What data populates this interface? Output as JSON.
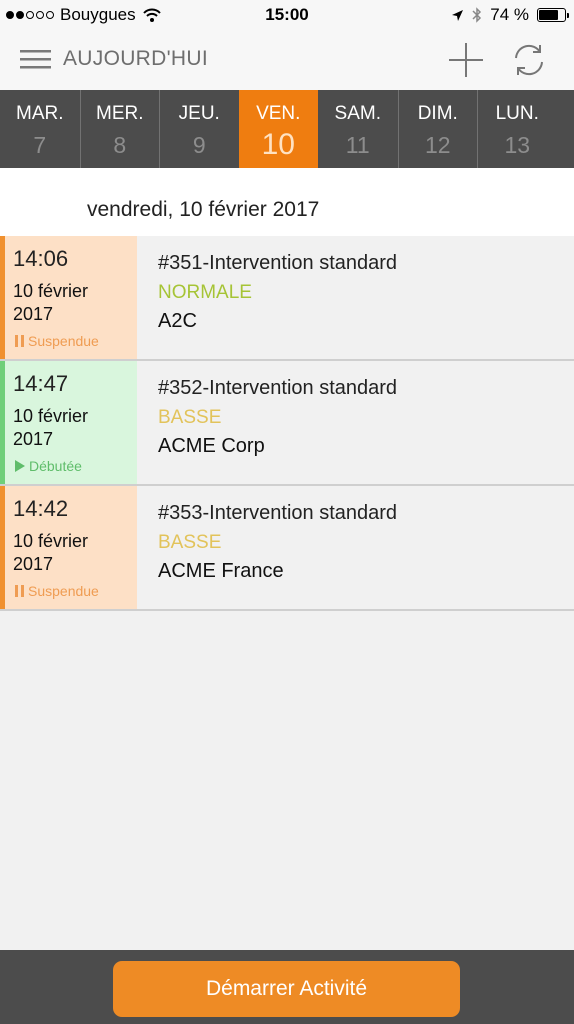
{
  "status_bar": {
    "carrier": "Bouygues",
    "time": "15:00",
    "battery": "74 %",
    "battery_level": 0.74
  },
  "nav": {
    "title": "AUJOURD'HUI"
  },
  "days": [
    {
      "name": "MAR.",
      "num": "7"
    },
    {
      "name": "MER.",
      "num": "8"
    },
    {
      "name": "JEU.",
      "num": "9"
    },
    {
      "name": "VEN.",
      "num": "10"
    },
    {
      "name": "SAM.",
      "num": "11"
    },
    {
      "name": "DIM.",
      "num": "12"
    },
    {
      "name": "LUN.",
      "num": "13"
    }
  ],
  "selected_day": "10",
  "date_heading": "vendredi, 10 février 2017",
  "interventions": [
    {
      "time": "14:06",
      "date": "10 février 2017",
      "status": "Suspendue",
      "title": "#351-Intervention standard",
      "priority": "NORMALE",
      "client": "A2C"
    },
    {
      "time": "14:47",
      "date": "10 février 2017",
      "status": "Débutée",
      "title": "#352-Intervention standard",
      "priority": "BASSE",
      "client": "ACME Corp"
    },
    {
      "time": "14:42",
      "date": "10 février 2017",
      "status": "Suspendue",
      "title": "#353-Intervention standard",
      "priority": "BASSE",
      "client": "ACME France"
    }
  ],
  "colors": {
    "accent": "#ef7d10",
    "priority_normale": "#a6c436",
    "priority_basse": "#e2c35a",
    "status_suspendue": "#f0902e",
    "status_debutee": "#6fcf79"
  },
  "icons": {
    "menu": "hamburger-menu-icon",
    "add": "plus-icon",
    "sync": "sync-icon",
    "suspendue": "pause-icon",
    "debutee": "play-icon"
  },
  "bottom": {
    "start_label": "Démarrer Activité"
  }
}
